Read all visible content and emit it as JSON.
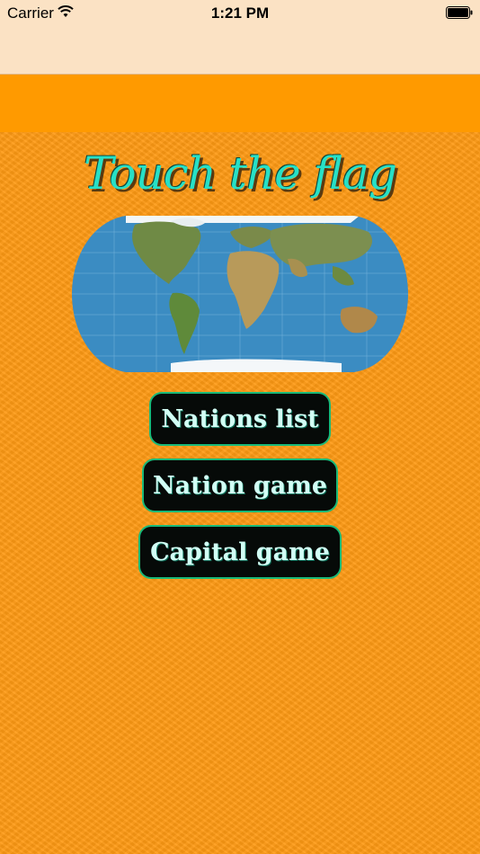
{
  "status_bar": {
    "carrier": "Carrier",
    "time": "1:21 PM"
  },
  "app": {
    "title": "Touch the flag"
  },
  "menu": {
    "nations_list": "Nations list",
    "nation_game": "Nation game",
    "capital_game": "Capital game"
  },
  "colors": {
    "background": "#ff9a14",
    "button_bg": "#060a08",
    "button_border": "#19b978",
    "title_color": "#27e0c6"
  }
}
